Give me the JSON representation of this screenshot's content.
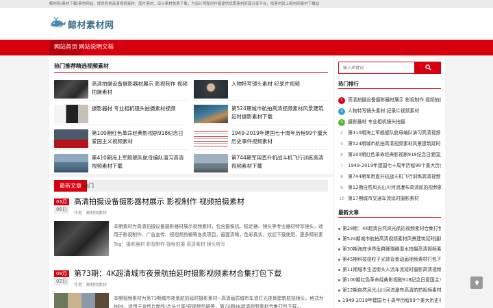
{
  "topbar": {
    "text": "鲸材网/素材下载/素材网站，提供各类高清视频素材、图片素材、设计素材免费下载，为设计师和创作者提供优质素材资源分享平台，找素材就上鲸材网素材下载站"
  },
  "logo": {
    "text": "鲸材素材网",
    "icon": "whale-logo-icon"
  },
  "nav": {
    "items": [
      {
        "label": "网站首页"
      },
      {
        "label": "网站说明文档"
      }
    ]
  },
  "featured": {
    "title": "热门推荐精选视频素材",
    "items": [
      {
        "title": "高清拍摄设备摄影器材展示 影视制作 视频拍摄素材"
      },
      {
        "title": "人物特写镜头素材 纪录片视频"
      },
      {
        "title": "摄影器材 专业相机镜头拍摄素材视频"
      },
      {
        "title": "第524期城市航拍高清视频素材风景建筑延时摄影素材下载"
      },
      {
        "title": "第100期红色革命经典影视剧918纪念日爱国主义视频素材"
      },
      {
        "title": "1949-2019年建国七十周年历程99个重大历史事件视频素材"
      },
      {
        "title": "第410期海上军舰舰队航母编队演习高清视频素材下载"
      },
      {
        "title": "第744期军用直升机战斗机飞行训练高清视频素材下载"
      }
    ]
  },
  "tabs": [
    {
      "label": "最新文章"
    },
    {
      "label": "热门"
    }
  ],
  "posts": [
    {
      "month": "03月",
      "day": "06日",
      "title": "高清拍摄设备摄影器材展示 影视制作 视频拍摄素材",
      "meta": "作者：鲸材网素材",
      "excerpt": "本期素材为高清拍摄设备摄影器材展示视频素材，包含摄像机、稳定器、镜头等专业器材特写镜头，适用于影视制作、广告宣传、短视频剪辑等各类项目，画面清晰，色彩真实，欢迎下载使用，更多精彩素材请持续关注本站更新...",
      "tags": "Tag：摄影器材 影视制作 视频拍摄 高清素材 镜头特写"
    },
    {
      "month": "08月",
      "day": "02日",
      "title": "第73期：4K超清城市夜景航拍延时摄影视频素材合集打包下载",
      "meta": "作者：鲸材网素材",
      "excerpt": "本期视频素材为第73期城市夜景航拍延时摄影素材~高清画质城市车流灯光夜景建筑航拍镜头，格式为MP4，适用于宣传片制作/片头片尾/短视频剪辑等，第73期4K超清视频素材合集打包下载..."
    }
  ],
  "sidebar": {
    "search_placeholder": "输入关键词",
    "rank_title": "热门排行",
    "rank": [
      {
        "n": "1",
        "title": "高清拍摄设备摄影器材展示 影视制作 视频拍摄素材"
      },
      {
        "n": "2",
        "title": "人物特写镜头素材 纪录片视频素材"
      },
      {
        "n": "3",
        "title": "摄影器材 专业相机镜头拍摄"
      },
      {
        "n": "4",
        "title": "第410期海上军舰舰队航母编队演习高清视频素材下载"
      },
      {
        "n": "5",
        "title": "第524期城市航拍高清视频素材风景建筑延时摄影素材下载"
      },
      {
        "n": "6",
        "title": "第100期红色革命经典影视剧918纪念日爱国主义视频素材"
      },
      {
        "n": "7",
        "title": "1949-2019年建国七十周年历程99个重大历史事件视频素材"
      },
      {
        "n": "8",
        "title": "第744期军用直升机战斗机飞行训练高清视频素材下载"
      },
      {
        "n": "9",
        "title": "第12期自然风光山川河流瀑布高清航拍视频素材"
      },
      {
        "n": "10",
        "title": "第17期城市交通车流延时摄影素材"
      }
    ],
    "recent_title": "最新文章",
    "recent": [
      {
        "title": "第28期：4K超清自然风光航拍视频素材合集打包下载"
      },
      {
        "title": "第524期城市航拍高清视频素材风景建筑延时摄影素材下载"
      },
      {
        "title": "第30期海底世界鱼群珊瑚礁潜水拍摄高清视频素材下载"
      },
      {
        "title": "第45期科技感粒子光效背景动画视频素材打包下载合集"
      },
      {
        "title": "第11期城市生活街头人流车流延时摄影高清视频素材下载"
      },
      {
        "title": "第100期红色革命经典影视剧918纪念日爱国主义视频素材"
      },
      {
        "title": "第12期自然风光山川河流瀑布高清航拍视频素材下载合集"
      },
      {
        "title": "1949-2019年建国七十周年历程99个重大历史事件视频素材"
      }
    ]
  },
  "colors": {
    "accent": "#d7000f",
    "logo": "#3a6f8a"
  }
}
